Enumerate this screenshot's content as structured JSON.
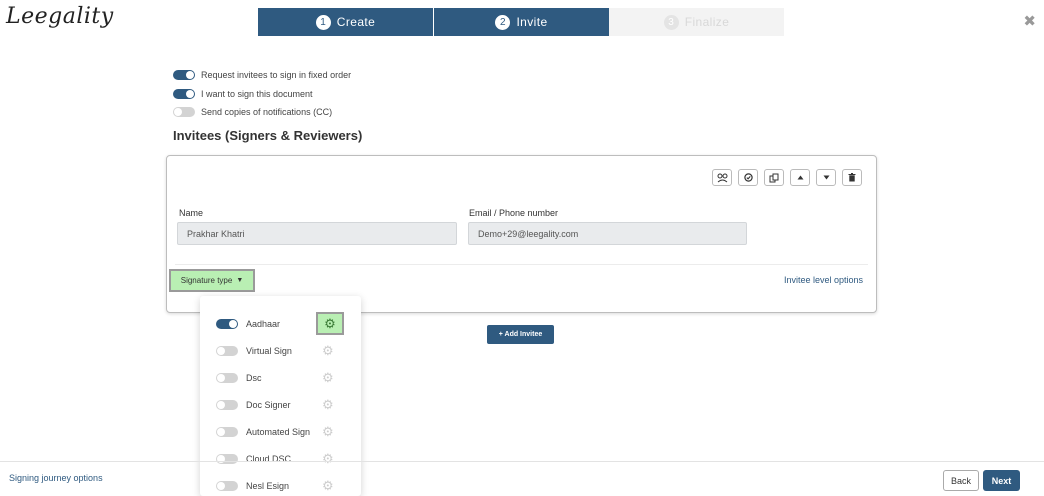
{
  "header": {
    "logo_text": "Leegality",
    "steps": [
      {
        "num": "1",
        "label": "Create",
        "state": "active"
      },
      {
        "num": "2",
        "label": "Invite",
        "state": "active"
      },
      {
        "num": "3",
        "label": "Finalize",
        "state": "disabled"
      }
    ],
    "close_icon": "✖"
  },
  "settings": [
    {
      "label": "Request invitees to sign in fixed order",
      "on": true
    },
    {
      "label": "I want to sign this document",
      "on": true
    },
    {
      "label": "Send copies of notifications (CC)",
      "on": false
    }
  ],
  "section_title": "Invitees (Signers & Reviewers)",
  "invitee": {
    "toolbar_icons": [
      "signer-reviewer-icon",
      "check-circle-icon",
      "copy-icon",
      "move-up-icon",
      "move-down-icon",
      "delete-icon"
    ],
    "name_label": "Name",
    "name_value": "Prakhar Khatri",
    "email_label": "Email / Phone number",
    "email_value": "Demo+29@leegality.com",
    "signature_type_label": "Signature type",
    "invitee_level_options": "Invitee level options"
  },
  "add_invitee_label": "+ Add Invitee",
  "signature_types": [
    {
      "label": "Aadhaar",
      "on": true
    },
    {
      "label": "Virtual Sign",
      "on": false
    },
    {
      "label": "Dsc",
      "on": false
    },
    {
      "label": "Doc Signer",
      "on": false
    },
    {
      "label": "Automated Sign",
      "on": false
    },
    {
      "label": "Cloud DSC",
      "on": false
    },
    {
      "label": "Nesl Esign",
      "on": false
    }
  ],
  "footer": {
    "journey_options": "Signing journey options",
    "back_label": "Back",
    "next_label": "Next"
  },
  "colors": {
    "primary": "#2f5a80",
    "highlight": "#b9efb3"
  }
}
